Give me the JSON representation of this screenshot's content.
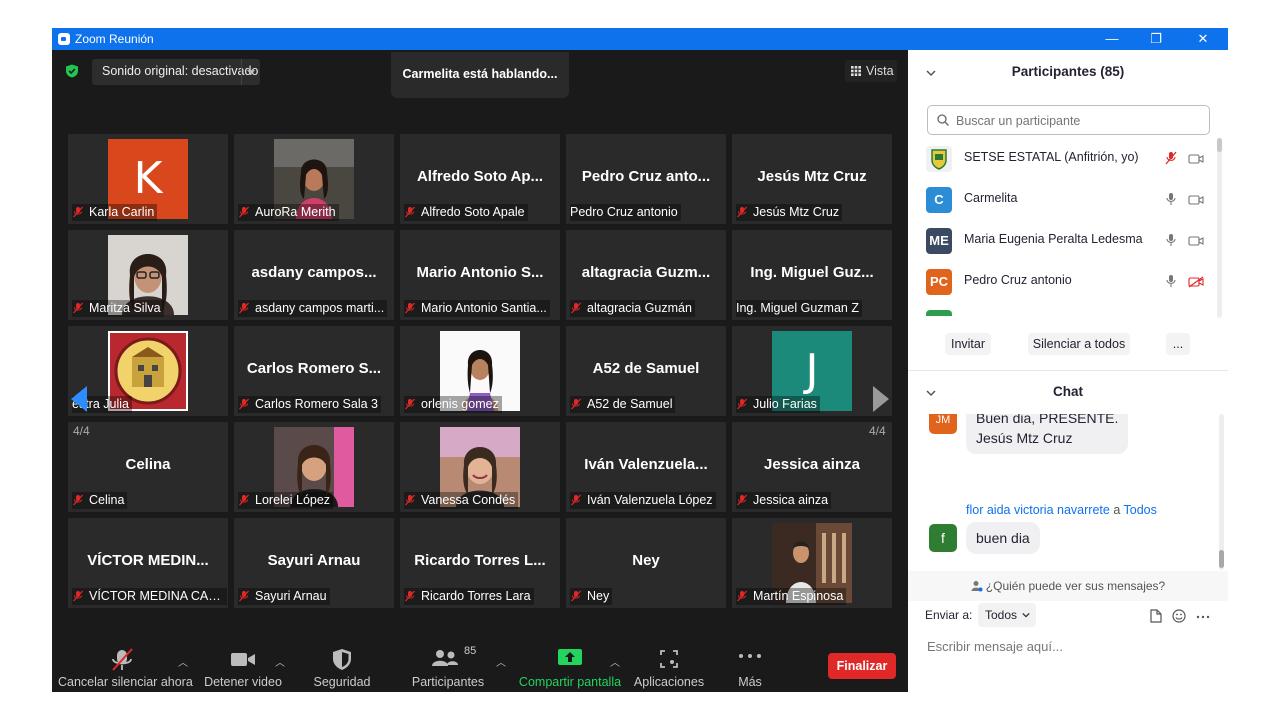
{
  "window": {
    "title": "Zoom Reunión",
    "minimize": "—",
    "restore": "❐",
    "close": "✕"
  },
  "meeting": {
    "sound_label": "Sonido original: desactivado",
    "speaking": "Carmelita está hablando...",
    "view_label": "Vista",
    "page_left": "4/4",
    "page_right": "4/4"
  },
  "tiles": [
    {
      "name": "Karla Carlin",
      "muted": true,
      "avatar": "K",
      "avatar_color": "#d9481c"
    },
    {
      "name": "AuroRa Merith",
      "muted": true,
      "photo": "woman-dark-hair-car"
    },
    {
      "big": "Alfredo Soto Ap...",
      "name": "Alfredo Soto Apale",
      "muted": true
    },
    {
      "big": "Pedro Cruz anto...",
      "name": "Pedro Cruz antonio",
      "muted": false
    },
    {
      "big": "Jesús Mtz Cruz",
      "name": "Jesús Mtz Cruz",
      "muted": true
    },
    {
      "name": "Maritza Silva",
      "muted": true,
      "photo": "woman-glasses"
    },
    {
      "big": "asdany campos...",
      "name": "asdany campos marti...",
      "muted": true
    },
    {
      "big": "Mario Antonio S...",
      "name": "Mario Antonio Santia...",
      "muted": true
    },
    {
      "big": "altagracia Guzm...",
      "name": "altagracia Guzmán",
      "muted": true
    },
    {
      "big": "Ing. Miguel Guz...",
      "name": "Ing. Miguel Guzman Z",
      "muted": false
    },
    {
      "name": "estra Julia",
      "muted": false,
      "photo": "school-emblem"
    },
    {
      "big": "Carlos Romero S...",
      "name": "Carlos Romero Sala 3",
      "muted": true
    },
    {
      "name": "orlenis gomez",
      "muted": true,
      "photo": "woman-white-background"
    },
    {
      "big": "A52 de Samuel",
      "name": "A52 de Samuel",
      "muted": true
    },
    {
      "name": "Julio Farias",
      "muted": true,
      "avatar": "J",
      "avatar_color": "#1b8a7a"
    },
    {
      "big": "Celina",
      "name": "Celina",
      "muted": true
    },
    {
      "name": "Lorelei López",
      "muted": true,
      "photo": "woman-pink"
    },
    {
      "name": "Vanessa Condés",
      "muted": true,
      "photo": "woman-smiling"
    },
    {
      "big": "Iván Valenzuela...",
      "name": "Iván Valenzuela López",
      "muted": true
    },
    {
      "big": "Jessica ainza",
      "name": "Jessica ainza",
      "muted": true
    },
    {
      "big": "VÍCTOR MEDIN...",
      "name": "VÍCTOR MEDINA CAS...",
      "muted": true
    },
    {
      "big": "Sayuri Arnau",
      "name": "Sayuri Arnau",
      "muted": true
    },
    {
      "big": "Ricardo Torres L...",
      "name": "Ricardo Torres Lara",
      "muted": true
    },
    {
      "big": "Ney",
      "name": "Ney",
      "muted": true
    },
    {
      "name": "Martín Espinosa",
      "muted": true,
      "photo": "man-white-shirt"
    }
  ],
  "toolbar": {
    "mute": "Cancelar silenciar ahora",
    "video": "Detener video",
    "security": "Seguridad",
    "participants": "Participantes",
    "participants_count": "85",
    "share": "Compartir pantalla",
    "apps": "Aplicaciones",
    "more": "Más",
    "end": "Finalizar"
  },
  "participants_panel": {
    "title": "Participantes (85)",
    "search_placeholder": "Buscar un participante",
    "rows": [
      {
        "name": "SETSE ESTATAL (Anfitrión, yo)",
        "initials": "",
        "color": "#e8e8e8",
        "mic": "muted",
        "video": "on"
      },
      {
        "name": "Carmelita",
        "initials": "C",
        "color": "#2d8cd6",
        "mic": "on",
        "video": "on"
      },
      {
        "name": "Maria Eugenia Peralta Ledesma",
        "initials": "ME",
        "color": "#3a4a63",
        "mic": "on",
        "video": "on"
      },
      {
        "name": "Pedro Cruz antonio",
        "initials": "PC",
        "color": "#e0641c",
        "mic": "on",
        "video": "off"
      }
    ],
    "invite": "Invitar",
    "mute_all": "Silenciar a todos",
    "more": "..."
  },
  "chat": {
    "title": "Chat",
    "msg1_initials": "JM",
    "msg1_line1": "Buen dia, PRESENTE.",
    "msg1_line2": "Jesús Mtz Cruz",
    "sender": "flor aida victoria navarrete",
    "sender_to": "a",
    "recipient": "Todos",
    "msg2_initials": "f",
    "msg2": "buen dia",
    "who_can_see": "¿Quién puede ver sus mensajes?",
    "send_to_label": "Enviar a:",
    "send_to_value": "Todos",
    "input_placeholder": "Escribir mensaje aquí..."
  }
}
